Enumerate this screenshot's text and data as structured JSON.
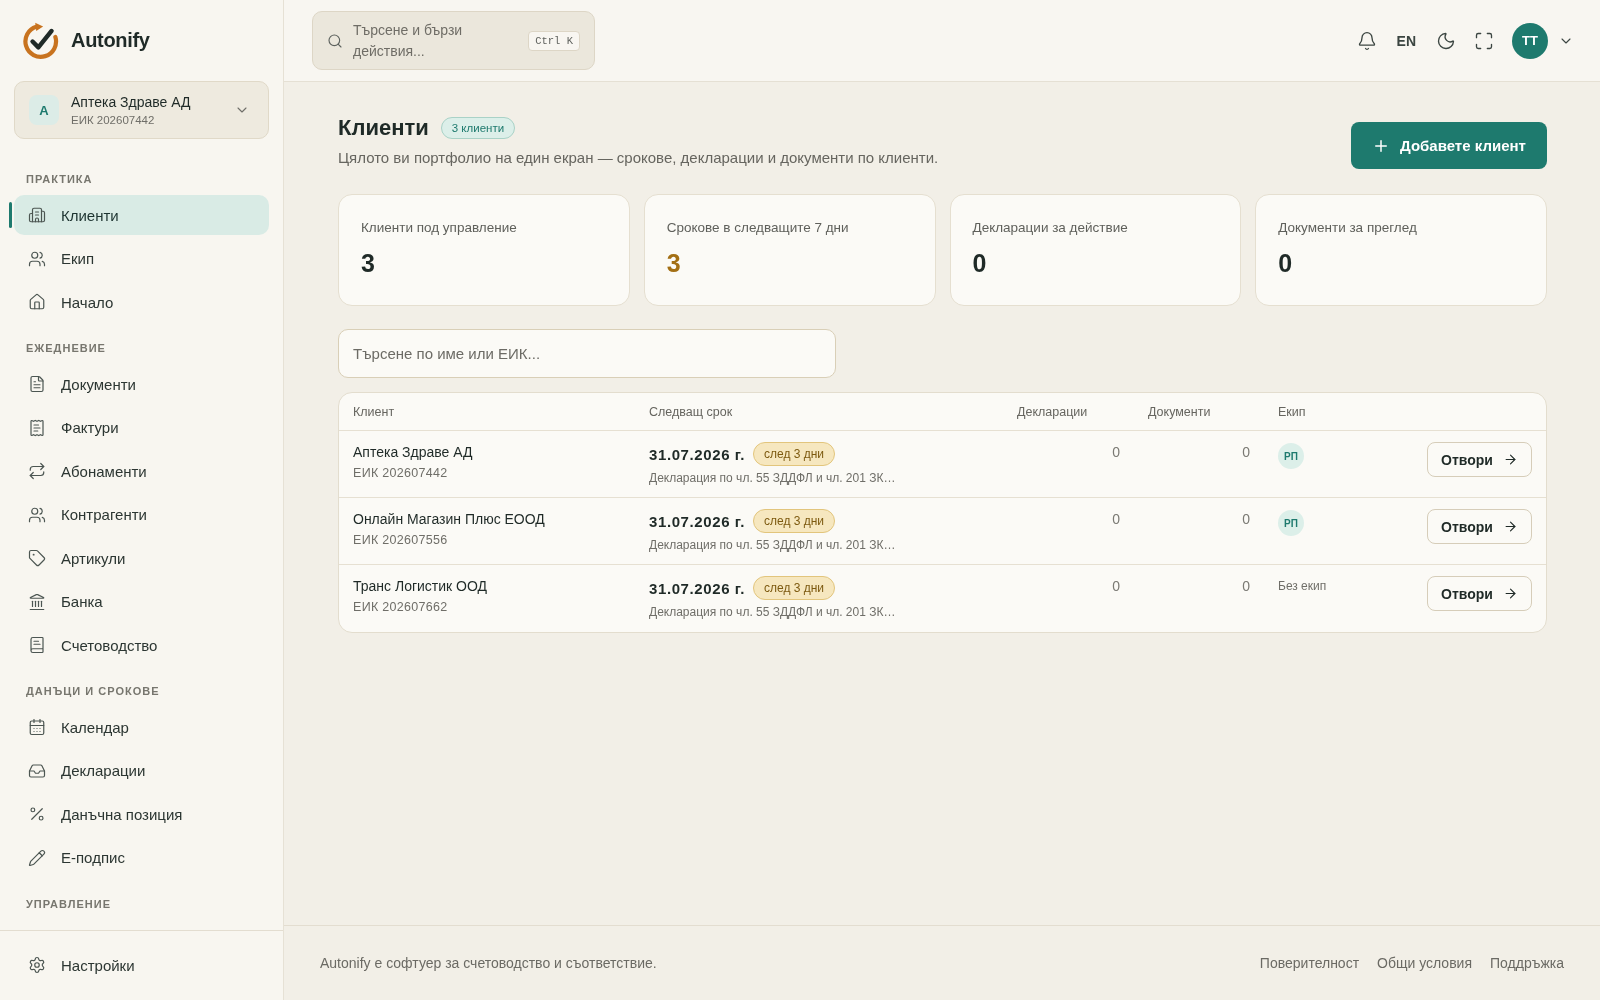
{
  "sidebar": {
    "brand": "Autonify",
    "organization": {
      "initial": "А",
      "name": "Аптека Здраве АД",
      "eik": "ЕИК 202607442"
    },
    "sections": [
      {
        "title": "ПРАКТИКА",
        "items": [
          {
            "label": "Клиенти",
            "selected": true
          },
          {
            "label": "Екип",
            "selected": false
          },
          {
            "label": "Начало",
            "selected": false
          }
        ]
      },
      {
        "title": "ЕЖЕДНЕВИЕ",
        "items": [
          {
            "label": "Документи",
            "selected": false
          },
          {
            "label": "Фактури",
            "selected": false
          },
          {
            "label": "Абонаменти",
            "selected": false
          },
          {
            "label": "Контрагенти",
            "selected": false
          },
          {
            "label": "Артикули",
            "selected": false
          },
          {
            "label": "Банка",
            "selected": false
          },
          {
            "label": "Счетоводство",
            "selected": false
          }
        ]
      },
      {
        "title": "ДАНЪЦИ И СРОКОВЕ",
        "items": [
          {
            "label": "Календар",
            "selected": false
          },
          {
            "label": "Декларации",
            "selected": false
          },
          {
            "label": "Данъчна позиция",
            "selected": false
          },
          {
            "label": "Е-подпис",
            "selected": false
          }
        ]
      },
      {
        "title": "УПРАВЛЕНИЕ"
      }
    ],
    "bottom_items": [
      {
        "label": "Настройки",
        "selected": false
      }
    ]
  },
  "topbar": {
    "search": {
      "placeholder": "Търсене и бързи действия...",
      "shortcut": "Ctrl K"
    },
    "language": "EN",
    "avatar": "TT"
  },
  "header": {
    "title": "Клиенти",
    "count": "3 клиенти",
    "subtitle": "Цялото ви портфолио на един екран — срокове, декларации и документи по клиенти.",
    "add_button": "Добавете клиент"
  },
  "stats": [
    {
      "label": "Клиенти под управление",
      "value": "3",
      "kind": "neutral"
    },
    {
      "label": "Срокове в следващите 7 дни",
      "value": "3",
      "kind": "warning"
    },
    {
      "label": "Декларации за действие",
      "value": "0",
      "kind": "neutral"
    },
    {
      "label": "Документи за преглед",
      "value": "0",
      "kind": "neutral"
    }
  ],
  "client_search": {
    "placeholder": "Търсене по име или ЕИК..."
  },
  "table": {
    "columns": [
      "Клиент",
      "Следващ срок",
      "Декларации",
      "Документи",
      "Екип"
    ],
    "rows": [
      {
        "name": "Аптека Здраве АД",
        "eik": "ЕИК 202607442",
        "deadline_date": "31.07.2026 г.",
        "deadline_badge": "след 3 дни",
        "deadline_description": "Декларация по чл. 55 ЗДДФЛ и чл. 201 ЗК…",
        "declarations": "0",
        "documents": "0",
        "team": {
          "kind": "initials",
          "text": "РП"
        },
        "action": "Отвори"
      },
      {
        "name": "Онлайн Магазин Плюс ЕООД",
        "eik": "ЕИК 202607556",
        "deadline_date": "31.07.2026 г.",
        "deadline_badge": "след 3 дни",
        "deadline_description": "Декларация по чл. 55 ЗДДФЛ и чл. 201 ЗК…",
        "declarations": "0",
        "documents": "0",
        "team": {
          "kind": "initials",
          "text": "РП"
        },
        "action": "Отвори"
      },
      {
        "name": "Транс Логистик ООД",
        "eik": "ЕИК 202607662",
        "deadline_date": "31.07.2026 г.",
        "deadline_badge": "след 3 дни",
        "deadline_description": "Декларация по чл. 55 ЗДДФЛ и чл. 201 ЗК…",
        "declarations": "0",
        "documents": "0",
        "team": {
          "kind": "none",
          "text": "Без екип"
        },
        "action": "Отвори"
      }
    ]
  },
  "footer": {
    "text": "Autonify е софтуер за счетоводство и съответствие.",
    "links": [
      "Поверителност",
      "Общи условия",
      "Поддръжка"
    ]
  }
}
